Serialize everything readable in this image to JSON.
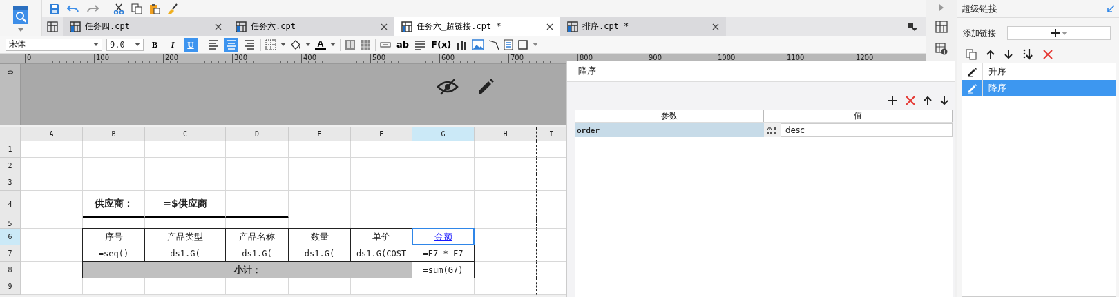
{
  "tabs": [
    {
      "label": "任务四.cpt",
      "selected": false
    },
    {
      "label": "任务六.cpt",
      "selected": false
    },
    {
      "label": "任务六_超链接.cpt *",
      "selected": true
    },
    {
      "label": "排序.cpt *",
      "selected": false
    }
  ],
  "format_toolbar": {
    "font": "宋体",
    "font_size": "9.0",
    "style_buttons": [
      {
        "label": "B",
        "selected": false
      },
      {
        "label": "I",
        "selected": false
      },
      {
        "label": "U",
        "selected": true
      }
    ],
    "align_buttons": [
      {
        "kind": "left",
        "selected": false
      },
      {
        "kind": "center",
        "selected": true
      },
      {
        "kind": "right",
        "selected": false
      }
    ],
    "font_color_label": "A",
    "text_icons": [
      "ab",
      "F(x)"
    ]
  },
  "ruler": {
    "corner_label": "0",
    "labels": [
      "0",
      "100",
      "200",
      "300",
      "400",
      "500",
      "600",
      "700",
      "800",
      "900",
      "1000",
      "1100",
      "1200"
    ]
  },
  "sheet": {
    "columns": [
      {
        "label": "A",
        "page_break": false
      },
      {
        "label": "B",
        "page_break": false
      },
      {
        "label": "C",
        "page_break": false
      },
      {
        "label": "D",
        "page_break": false
      },
      {
        "label": "E",
        "page_break": false
      },
      {
        "label": "F",
        "page_break": false
      },
      {
        "label": "G",
        "page_break": false
      },
      {
        "label": "H",
        "page_break": true
      },
      {
        "label": "I",
        "page_break": false
      }
    ],
    "rows": [
      {
        "number": "1"
      },
      {
        "number": "2"
      },
      {
        "number": "3"
      },
      {
        "number": "4",
        "cells": [
          {
            "kind": "empty"
          },
          {
            "kind": "label",
            "text": "供应商：",
            "rule_below": true,
            "selected": false
          },
          {
            "kind": "label",
            "text": "=$供应商",
            "rule_below": true,
            "selected": false
          },
          {
            "kind": "empty",
            "rule_below": true
          }
        ]
      },
      {
        "number": "5"
      },
      {
        "number": "6",
        "cells": [
          {
            "kind": "empty"
          },
          {
            "kind": "header",
            "text": "序号",
            "selected": false
          },
          {
            "kind": "header",
            "text": "产品类型",
            "selected": false
          },
          {
            "kind": "header",
            "text": "产品名称",
            "selected": false
          },
          {
            "kind": "header",
            "text": "数量",
            "selected": false
          },
          {
            "kind": "header",
            "text": "单价",
            "selected": false
          },
          {
            "kind": "link",
            "text": "金额",
            "selected": true
          }
        ]
      },
      {
        "number": "7",
        "cells": [
          {
            "kind": "empty"
          },
          {
            "kind": "formula",
            "text": "=seq()",
            "selected": false
          },
          {
            "kind": "formula",
            "text": "ds1.G(",
            "selected": false
          },
          {
            "kind": "formula",
            "text": "ds1.G(",
            "selected": false
          },
          {
            "kind": "formula",
            "text": "ds1.G(",
            "selected": false
          },
          {
            "kind": "formula",
            "text": "ds1.G(COST",
            "selected": false
          },
          {
            "kind": "formula",
            "text": "=E7 * F7",
            "selected": false
          }
        ]
      },
      {
        "number": "8",
        "cells": [
          {
            "kind": "empty"
          },
          {
            "kind": "subtotal",
            "text": "小计：",
            "selected": false
          },
          {
            "kind": "merged"
          },
          {
            "kind": "merged"
          },
          {
            "kind": "merged"
          },
          {
            "kind": "merged"
          },
          {
            "kind": "formula",
            "text": "=sum(G7)",
            "selected": false
          }
        ]
      },
      {
        "number": "9"
      }
    ]
  },
  "dialog": {
    "title": "降序",
    "columns": [
      "参数",
      "值"
    ],
    "rows": [
      {
        "param": "order",
        "value": "desc"
      }
    ]
  },
  "side_panel": {
    "title": "超级链接",
    "add_label": "添加链接",
    "links": [
      {
        "label": "升序",
        "selected": false
      },
      {
        "label": "降序",
        "selected": true
      }
    ]
  }
}
